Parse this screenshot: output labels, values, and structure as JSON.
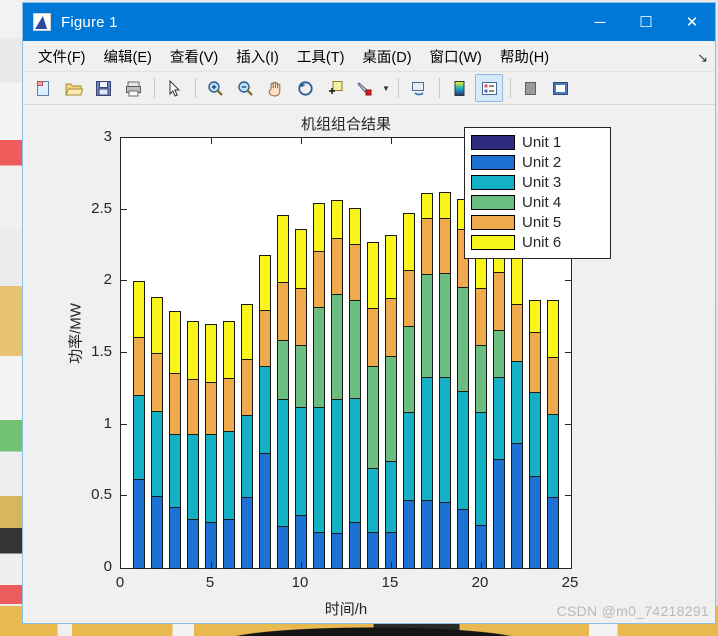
{
  "window": {
    "title": "Figure 1",
    "app_icon": "matlab-icon",
    "minimize": "─",
    "maximize": "☐",
    "close": "✕"
  },
  "menubar": {
    "items": [
      {
        "label": "文件(F)",
        "name": "menu-file"
      },
      {
        "label": "编辑(E)",
        "name": "menu-edit"
      },
      {
        "label": "查看(V)",
        "name": "menu-view"
      },
      {
        "label": "插入(I)",
        "name": "menu-insert"
      },
      {
        "label": "工具(T)",
        "name": "menu-tools"
      },
      {
        "label": "桌面(D)",
        "name": "menu-desktop"
      },
      {
        "label": "窗口(W)",
        "name": "menu-window"
      },
      {
        "label": "帮助(H)",
        "name": "menu-help"
      }
    ],
    "overflow_arrow": "↘"
  },
  "toolbar": {
    "buttons": [
      {
        "name": "new-figure-icon",
        "glyph": "὜B"
      },
      {
        "name": "open-file-icon",
        "glyph": "Ὄ2"
      },
      {
        "name": "save-figure-icon",
        "glyph": "ὋE"
      },
      {
        "name": "print-figure-icon",
        "glyph": "὚8"
      },
      {
        "name": "pointer-select-icon",
        "glyph": "➤"
      },
      {
        "name": "zoom-in-icon",
        "glyph": "⊕"
      },
      {
        "name": "zoom-out-icon",
        "glyph": "⊖"
      },
      {
        "name": "pan-hand-icon",
        "glyph": "✋"
      },
      {
        "name": "rotate-3d-icon",
        "glyph": "↻"
      },
      {
        "name": "data-cursor-icon",
        "glyph": "ὌB"
      },
      {
        "name": "brush-data-icon",
        "glyph": "὘C"
      },
      {
        "name": "link-plot-icon",
        "glyph": "ὑ7"
      },
      {
        "name": "colorbar-icon",
        "glyph": "▤"
      },
      {
        "name": "legend-icon",
        "glyph": "≡"
      },
      {
        "name": "hide-plot-tools-icon",
        "glyph": "■"
      },
      {
        "name": "show-plot-tools-icon",
        "glyph": "▣"
      }
    ]
  },
  "watermark": "CSDN @m0_74218291",
  "chart_data": {
    "type": "bar",
    "stacked": true,
    "title": "机组组合结果",
    "xlabel": "时间/h",
    "ylabel": "功率/MW",
    "xlim": [
      0,
      25
    ],
    "ylim": [
      0,
      3
    ],
    "xticks": [
      0,
      5,
      10,
      15,
      20,
      25
    ],
    "yticks": [
      0,
      0.5,
      1,
      1.5,
      2,
      2.5,
      3
    ],
    "ytick_labels": [
      "0",
      "0.5",
      "1",
      "1.5",
      "2",
      "2.5",
      "3"
    ],
    "xtick_labels": [
      "0",
      "5",
      "10",
      "15",
      "20",
      "25"
    ],
    "grid": false,
    "legend_position": "northeast",
    "categories": [
      1,
      2,
      3,
      4,
      5,
      6,
      7,
      8,
      9,
      10,
      11,
      12,
      13,
      14,
      15,
      16,
      17,
      18,
      19,
      20,
      21,
      22,
      23,
      24
    ],
    "series": [
      {
        "name": "Unit 1",
        "color": "#2f2b7f",
        "values": [
          0,
          0,
          0,
          0,
          0,
          0,
          0,
          0,
          0,
          0,
          0,
          0,
          0,
          0,
          0,
          0,
          0,
          0,
          0,
          0,
          0,
          0,
          0,
          0
        ]
      },
      {
        "name": "Unit 2",
        "color": "#1c72d4",
        "values": [
          0.63,
          0.51,
          0.43,
          0.35,
          0.33,
          0.35,
          0.5,
          0.81,
          0.3,
          0.38,
          0.26,
          0.25,
          0.33,
          0.26,
          0.26,
          0.48,
          0.48,
          0.47,
          0.42,
          0.31,
          0.77,
          0.88,
          0.65,
          0.5
        ]
      },
      {
        "name": "Unit 3",
        "color": "#14b0c4",
        "values": [
          0.59,
          0.6,
          0.52,
          0.6,
          0.62,
          0.62,
          0.58,
          0.61,
          0.89,
          0.76,
          0.88,
          0.94,
          0.87,
          0.45,
          0.5,
          0.62,
          0.87,
          0.88,
          0.83,
          0.79,
          0.58,
          0.58,
          0.59,
          0.59
        ]
      },
      {
        "name": "Unit 4",
        "color": "#6cbe80",
        "values": [
          0,
          0,
          0,
          0,
          0,
          0,
          0,
          0,
          0.42,
          0.44,
          0.7,
          0.74,
          0.69,
          0.72,
          0.74,
          0.61,
          0.72,
          0.73,
          0.73,
          0.48,
          0.33,
          0,
          0,
          0
        ]
      },
      {
        "name": "Unit 5",
        "color": "#efab4b",
        "values": [
          0.41,
          0.41,
          0.43,
          0.39,
          0.37,
          0.38,
          0.4,
          0.4,
          0.41,
          0.4,
          0.4,
          0.4,
          0.4,
          0.41,
          0.41,
          0.4,
          0.4,
          0.39,
          0.41,
          0.4,
          0.41,
          0.4,
          0.43,
          0.4
        ]
      },
      {
        "name": "Unit 6",
        "color": "#f8f51a",
        "values": [
          0.4,
          0.4,
          0.44,
          0.41,
          0.41,
          0.4,
          0.39,
          0.39,
          0.48,
          0.42,
          0.34,
          0.27,
          0.26,
          0.47,
          0.45,
          0.4,
          0.18,
          0.19,
          0.22,
          0.42,
          0.31,
          0.64,
          0.23,
          0.41
        ]
      }
    ],
    "totals": [
      2.03,
      1.92,
      1.82,
      1.75,
      1.73,
      1.75,
      1.87,
      2.21,
      2.5,
      2.4,
      2.58,
      2.6,
      2.55,
      2.31,
      2.36,
      2.51,
      2.65,
      2.66,
      2.61,
      2.4,
      2.4,
      2.5,
      1.9,
      1.9
    ]
  }
}
